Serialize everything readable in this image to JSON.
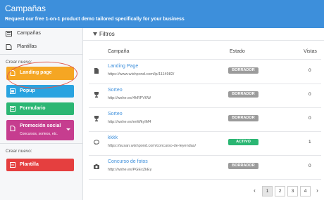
{
  "header": {
    "title": "Campañas",
    "subtitle": "Request our free 1-on-1 product demo tailored specifically for your business"
  },
  "sidebar": {
    "nav": [
      {
        "label": "Campañas",
        "icon": "campaigns-icon"
      },
      {
        "label": "Plantillas",
        "icon": "templates-icon"
      }
    ],
    "crear1_label": "Crear nuevo:",
    "types": [
      {
        "label": "Landing page",
        "color": "#f5a623",
        "icon": "landing-page-icon"
      },
      {
        "label": "Popup",
        "color": "#29a3e0",
        "icon": "popup-icon"
      },
      {
        "label": "Formulario",
        "color": "#2bb673",
        "icon": "form-icon"
      },
      {
        "label": "Promoción social",
        "sub": "Concursos, sorteos, etc.",
        "color": "#c63d8f",
        "icon": "social-promo-icon"
      }
    ],
    "crear2_label": "Crear nuevo:",
    "template_btn": {
      "label": "Plantilla",
      "color": "#e53f3f",
      "icon": "template-icon"
    }
  },
  "main": {
    "filter_label": "Filtros",
    "columns": {
      "campaign": "Campaña",
      "status": "Estado",
      "views": "Vistas"
    },
    "rows": [
      {
        "icon": "document-icon",
        "name": "Landing Page",
        "url": "https://www.wishpond.com/lp/1114982/",
        "status": "BORRADOR",
        "status_color": "#9b9b9b",
        "views": "0"
      },
      {
        "icon": "trophy-icon",
        "name": "Sorteo",
        "url": "http://wshe.es/4hRPV6W",
        "status": "BORRADOR",
        "status_color": "#9b9b9b",
        "views": "0"
      },
      {
        "icon": "trophy-icon",
        "name": "Sorteo",
        "url": "http://wshe.es/enWkyIM4",
        "status": "BORRADOR",
        "status_color": "#9b9b9b",
        "views": "0"
      },
      {
        "icon": "comment-icon",
        "name": "kkkk",
        "url": "https://susan.wishpond.com/concurso-de-leyendas/",
        "status": "ACTIVO",
        "status_color": "#2bb673",
        "views": "1"
      },
      {
        "icon": "camera-icon",
        "name": "Concurso de fotos",
        "url": "http://wshe.es/PGExZkEy",
        "status": "BORRADOR",
        "status_color": "#9b9b9b",
        "views": "0"
      }
    ],
    "pagination": {
      "prev": "‹",
      "pages": [
        "1",
        "2",
        "3",
        "4"
      ],
      "next": "›",
      "current": "1"
    }
  }
}
